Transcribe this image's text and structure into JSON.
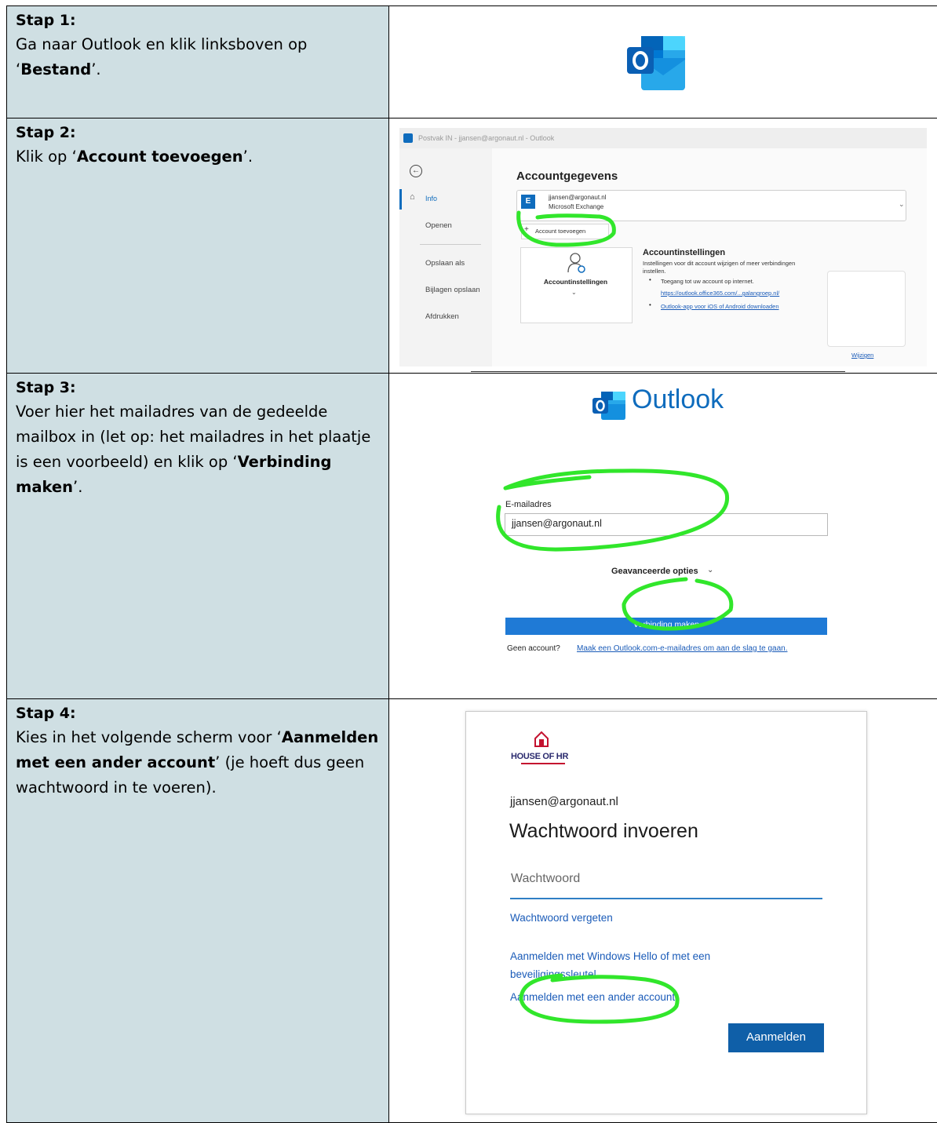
{
  "steps": [
    {
      "title": "Stap 1:",
      "text_before": "Ga naar Outlook en klik linksboven op ‘",
      "bold": "Bestand",
      "text_after": "’."
    },
    {
      "title": "Stap 2:",
      "text_before": "Klik op ‘",
      "bold": "Account toevoegen",
      "text_after": "’."
    },
    {
      "title": "Stap 3:",
      "text_before": "Voer hier het mailadres van de gedeelde mailbox in (let op: het mailadres in het plaatje is een voorbeeld) en klik op ‘",
      "bold": "Verbinding maken",
      "text_after": "’."
    },
    {
      "title": "Stap 4:",
      "text_before": "Kies in het volgende scherm voor ‘",
      "bold": "Aanmelden met een ander account",
      "text_after": "’ (je hoeft dus geen wachtwoord in te voeren)."
    }
  ],
  "step2_screenshot": {
    "titlebar": "Postvak IN -   jjansen@argonaut.nl   -  Outlook",
    "nav": [
      "Info",
      "Openen",
      "Opslaan als",
      "Bijlagen opslaan",
      "Afdrukken"
    ],
    "heading": "Accountgegevens",
    "account_email": "jjansen@argonaut.nl",
    "account_type": "Microsoft Exchange",
    "add_account": "Account toevoegen",
    "tile_label": "Accountinstellingen",
    "settings_title": "Accountinstellingen",
    "settings_desc": "Instellingen voor dit account wijzigen of meer verbindingen instellen.",
    "bullet1": "Toegang tot uw account op internet.",
    "bullet1_link": "https://outlook.office365.com/...galangroep.nl/",
    "bullet2_link": "Outlook-app voor iOS of Android downloaden",
    "change_link": "Wijzigen"
  },
  "step3_screenshot": {
    "brand": "Outlook",
    "email_label": "E-mailadres",
    "email_value": "jjansen@argonaut.nl",
    "advanced": "Geavanceerde opties",
    "connect_button": "Verbinding maken",
    "no_account": "Geen account?",
    "create_link": "Maak een Outlook.com-e-mailadres om aan de slag te gaan."
  },
  "step4_screenshot": {
    "logo_text": "HOUSE OF HR",
    "email": "jjansen@argonaut.nl",
    "heading": "Wachtwoord invoeren",
    "password_placeholder": "Wachtwoord",
    "forgot_link": "Wachtwoord vergeten",
    "hello_link": "Aanmelden met Windows Hello of met een beveiligingssleutel",
    "other_account_link": "Aanmelden met een ander account",
    "signin_button": "Aanmelden"
  },
  "colors": {
    "left_cell_bg": "#cfdfe3",
    "highlight_green": "#31e62b",
    "outlook_blue": "#0f6cbd",
    "link_blue": "#1a5bb8"
  }
}
